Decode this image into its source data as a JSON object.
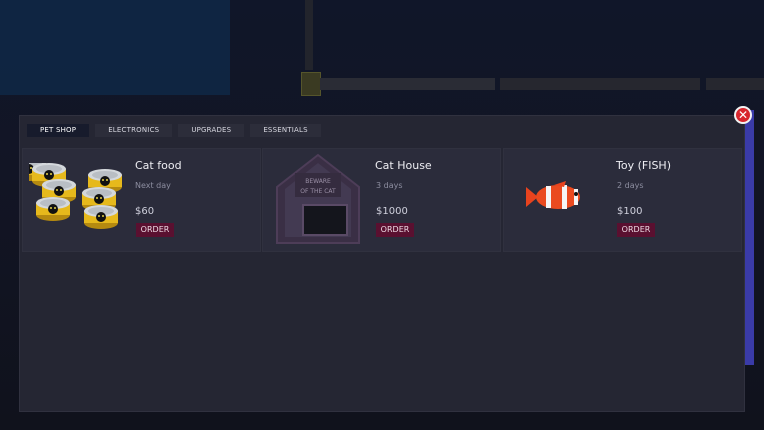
{
  "tabs": [
    {
      "label": "PET SHOP",
      "active": true
    },
    {
      "label": "ELECTRONICS",
      "active": false
    },
    {
      "label": "UPGRADES",
      "active": false
    },
    {
      "label": "ESSENTIALS",
      "active": false
    }
  ],
  "close_icon": "close-icon",
  "items": [
    {
      "name": "Cat food",
      "delivery": "Next day",
      "price": "$60",
      "order_label": "ORDER",
      "image": "cat-food-cans"
    },
    {
      "name": "Cat House",
      "delivery": "3 days",
      "price": "$1000",
      "order_label": "ORDER",
      "image": "cat-house",
      "sign_line1": "BEWARE",
      "sign_line2": "OF THE CAT"
    },
    {
      "name": "Toy (FISH)",
      "delivery": "2 days",
      "price": "$100",
      "order_label": "ORDER",
      "image": "clownfish-toy"
    }
  ],
  "colors": {
    "order_bg": "#5a1030",
    "panel_bg": "#252633",
    "close_red": "#d8262d"
  }
}
